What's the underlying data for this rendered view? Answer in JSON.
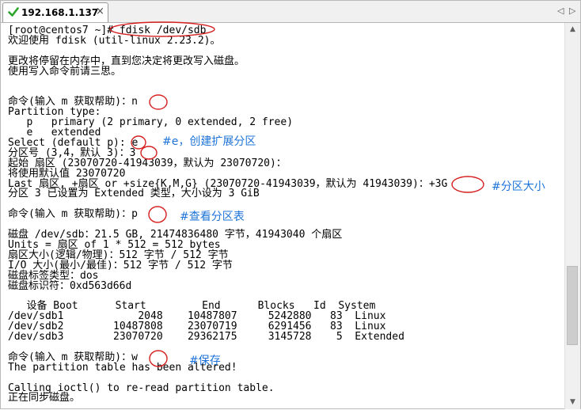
{
  "tab": {
    "title": "192.168.1.137",
    "close": "×"
  },
  "nav": {
    "left": "◁",
    "right": "▷"
  },
  "scrollbar": {
    "up": "▲",
    "down": "▼",
    "position": 0.82
  },
  "terminal_lines": [
    "[root@centos7 ~]# fdisk /dev/sdb",
    "欢迎使用 fdisk (util-linux 2.23.2)。",
    "",
    "更改将停留在内存中，直到您决定将更改写入磁盘。",
    "使用写入命令前请三思。",
    "",
    "",
    "命令(输入 m 获取帮助)：n",
    "Partition type:",
    "   p   primary (2 primary, 0 extended, 2 free)",
    "   e   extended",
    "Select (default p): e",
    "分区号 (3,4，默认 3)：3",
    "起始 扇区 (23070720-41943039，默认为 23070720)：",
    "将使用默认值 23070720",
    "Last 扇区, +扇区 or +size{K,M,G} (23070720-41943039，默认为 41943039)：+3G",
    "分区 3 已设置为 Extended 类型，大小设为 3 GiB",
    "",
    "命令(输入 m 获取帮助)：p",
    "",
    "磁盘 /dev/sdb：21.5 GB, 21474836480 字节，41943040 个扇区",
    "Units = 扇区 of 1 * 512 = 512 bytes",
    "扇区大小(逻辑/物理)：512 字节 / 512 字节",
    "I/O 大小(最小/最佳)：512 字节 / 512 字节",
    "磁盘标签类型：dos",
    "磁盘标识符：0xd563d66d",
    "",
    "   设备 Boot      Start         End      Blocks   Id  System",
    "/dev/sdb1            2048    10487807     5242880   83  Linux",
    "/dev/sdb2        10487808    23070719     6291456   83  Linux",
    "/dev/sdb3        23070720    29362175     3145728    5  Extended",
    "",
    "命令(输入 m 获取帮助)：w",
    "The partition table has been altered!",
    "",
    "Calling ioctl() to re-read partition table.",
    "正在同步磁盘。"
  ],
  "annotations": [
    "#e，创建扩展分区",
    "#分区大小",
    "#查看分区表",
    "#保存"
  ],
  "colors": {
    "annotation": "#1e73d8",
    "circle": "#d62020",
    "tab_check": "#2aa52a"
  }
}
